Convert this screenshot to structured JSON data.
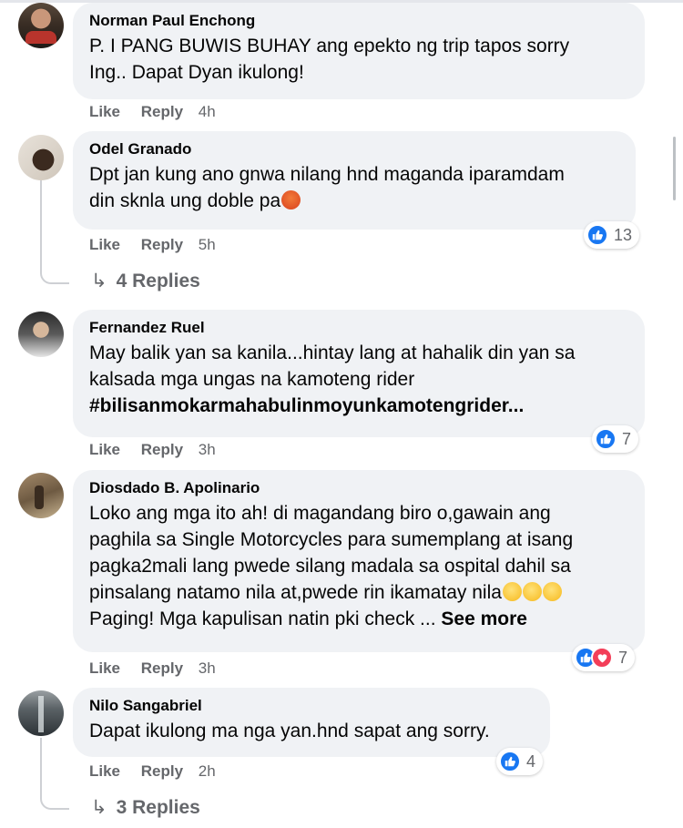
{
  "actions": {
    "like": "Like",
    "reply": "Reply"
  },
  "comments": [
    {
      "author": "Norman Paul Enchong",
      "lines": [
        "P. I PANG BUWIS BUHAY ang epekto ng trip tapos sorry",
        "Ing.. Dapat Dyan ikulong!"
      ],
      "time": "4h"
    },
    {
      "author": "Odel Granado",
      "lines": [
        "Dpt jan kung ano gnwa nilang hnd maganda iparamdam",
        "din sknla ung doble pa"
      ],
      "emoji": "angry-face-icon",
      "time": "5h",
      "reaction_count": "13",
      "replies": "4 Replies"
    },
    {
      "author": "Fernandez Ruel",
      "lines": [
        "May balik yan sa kanila...hintay lang at hahalik din yan sa",
        "kalsada mga ungas na kamoteng rider"
      ],
      "hashtag": "#bilisanmokarmahabulinmoyunkamotengrider...",
      "time": "3h",
      "reaction_count": "7"
    },
    {
      "author": "Diosdado B. Apolinario",
      "lines": [
        "Loko ang mga ito ah! di magandang biro o,gawain ang",
        "paghila sa Single Motorcycles para sumemplang at isang",
        "pagka2mali lang pwede silang madala sa ospital dahil sa",
        "pinsalang natamo nila at,pwede rin ikamatay nila"
      ],
      "last_line": "Paging! Mga kapulisan natin pki check ...",
      "see_more": "See more",
      "time": "3h",
      "reaction_count": "7"
    },
    {
      "author": "Nilo Sangabriel",
      "lines": [
        "Dapat ikulong ma nga yan.hnd sapat ang sorry."
      ],
      "time": "2h",
      "reaction_count": "4",
      "replies": "3 Replies"
    }
  ],
  "colors": {
    "like_blue": "#1877f2",
    "love_red": "#f33e58",
    "bubble_bg": "#f0f2f5",
    "meta_gray": "#65676b"
  }
}
